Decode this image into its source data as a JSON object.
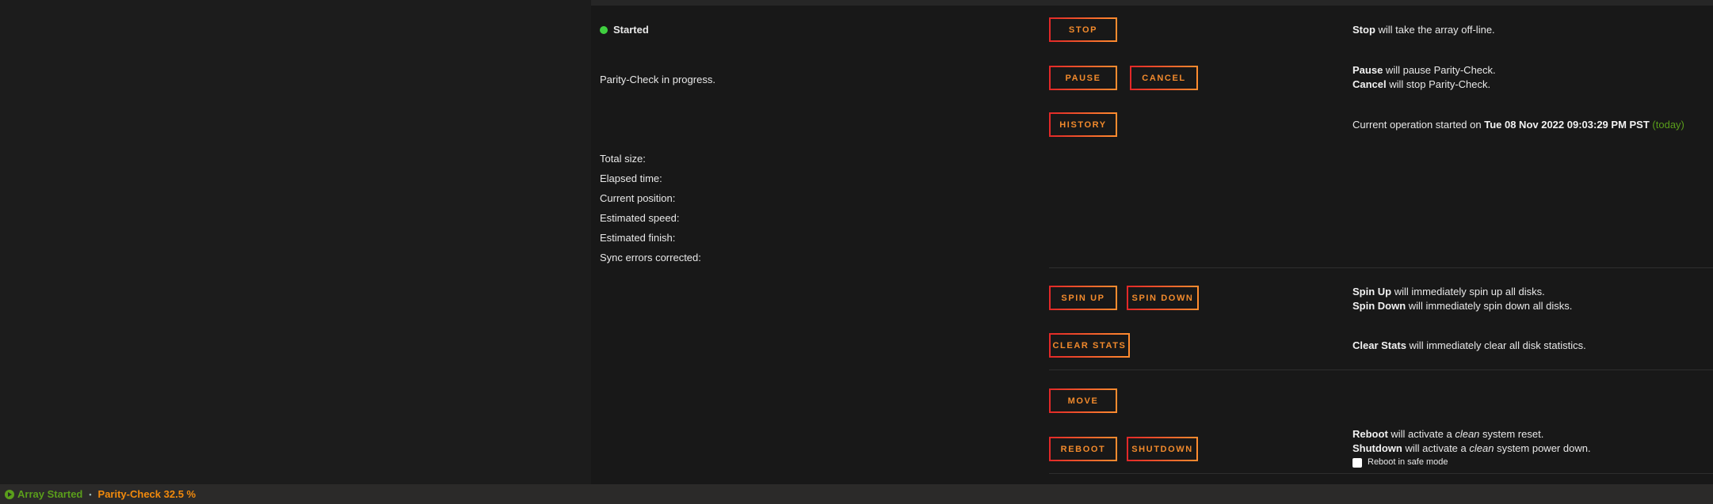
{
  "status": {
    "state": "Started",
    "state_color": "#3fcf3f",
    "operation": "Parity-Check in progress."
  },
  "stats_labels": [
    "Total size:",
    "Elapsed time:",
    "Current position:",
    "Estimated speed:",
    "Estimated finish:",
    "Sync errors corrected:"
  ],
  "buttons": {
    "stop": "STOP",
    "pause": "PAUSE",
    "cancel": "CANCEL",
    "history": "HISTORY",
    "spin_up": "SPIN UP",
    "spin_down": "SPIN DOWN",
    "clear_stats": "CLEAR STATS",
    "move": "MOVE",
    "reboot": "REBOOT",
    "shutdown": "SHUTDOWN"
  },
  "descriptions": {
    "stop": {
      "b": "Stop",
      "t": " will take the array off-line."
    },
    "pause": {
      "b": "Pause",
      "t": " will pause Parity-Check."
    },
    "cancel": {
      "b": "Cancel",
      "t": " will stop Parity-Check."
    },
    "history": {
      "t": "Current operation started on ",
      "b": "Tue 08 Nov 2022 09:03:29 PM PST",
      "g": "(today)"
    },
    "spin_up": {
      "b": "Spin Up",
      "t": " will immediately spin up all disks."
    },
    "spin_down": {
      "b": "Spin Down",
      "t": " will immediately spin down all disks."
    },
    "clear_stats": {
      "b": "Clear Stats",
      "t": " will immediately clear all disk statistics."
    },
    "reboot": {
      "b": "Reboot",
      "t": " will activate a ",
      "i": "clean",
      "t2": " system reset."
    },
    "shutdown": {
      "b": "Shutdown",
      "t": " will activate a ",
      "i": "clean",
      "t2": " system power down."
    },
    "safe_mode": "Reboot in safe mode"
  },
  "footer": {
    "array": "Array Started",
    "separator": "•",
    "progress": "Parity-Check 32.5 %",
    "progress_value": 32.5,
    "array_color": "#5a9e1b",
    "progress_color": "#f28a0c"
  },
  "colors": {
    "accent": "#f28a2c",
    "today": "#5a9e1b"
  }
}
